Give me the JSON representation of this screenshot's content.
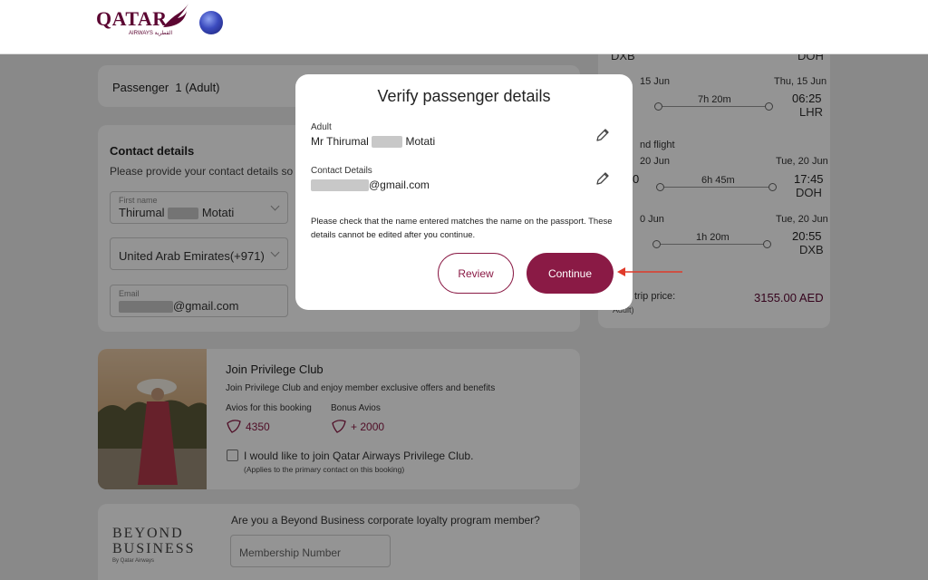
{
  "header": {
    "brand": "QATAR",
    "brand_sub": "AIRWAYS القطرية"
  },
  "passenger_card": {
    "title": "Passenger  1 (Adult)"
  },
  "contact": {
    "title": "Contact details",
    "subtitle": "Please provide your contact details so",
    "first_name": {
      "label": "First name",
      "value_first": "Thirumal",
      "value_last": "Motati"
    },
    "country": {
      "value": "United Arab Emirates(+971)"
    },
    "email": {
      "label": "Email",
      "value": "@gmail.com"
    }
  },
  "privilege": {
    "title": "Join Privilege Club",
    "desc": "Join Privilege Club and enjoy member exclusive offers and benefits",
    "avios_label": "Avios for this booking",
    "avios_value": "4350",
    "bonus_label": "Bonus Avios",
    "bonus_value": "+ 2000",
    "checkbox_label": "I would like to join Qatar Airways Privilege Club.",
    "checkbox_note": "(Applies to the primary contact on this booking)"
  },
  "beyond": {
    "logo_line1": "BEYOND",
    "logo_line2": "BUSINESS",
    "logo_line3": "By Qatar Airways",
    "question": "Are you a Beyond Business corporate loyalty program member?",
    "placeholder": "Membership Number"
  },
  "itinerary": {
    "top_left_code": "DXB",
    "top_right_code": "DOH",
    "seg1": {
      "date_left": "15 Jun",
      "date_right": "Thu, 15 Jun",
      "duration": "7h 20m",
      "time_right": "06:25",
      "code_right": "LHR"
    },
    "return_label": "nd flight",
    "seg2": {
      "date_left": "20 Jun",
      "date_right": "Tue, 20 Jun",
      "time_left": "0",
      "duration": "6h 45m",
      "time_right": "17:45",
      "code_right": "DOH"
    },
    "seg3": {
      "date_left": "0 Jun",
      "date_right": "Tue, 20 Jun",
      "duration": "1h 20m",
      "time_right": "20:55",
      "code_right": "DXB"
    },
    "price_label": "trip price:",
    "price_sub": "Adult)",
    "price_value": "3155.00 AED"
  },
  "modal": {
    "title": "Verify passenger details",
    "adult_label": "Adult",
    "adult_name_first": "Mr Thirumal",
    "adult_name_last": "Motati",
    "contact_label": "Contact Details",
    "contact_value": "@gmail.com",
    "note": "Please check that the name entered matches the name on the passport. These details cannot be edited after you continue.",
    "review_label": "Review",
    "continue_label": "Continue"
  },
  "colors": {
    "brand": "#5c0632",
    "accent": "#8a1a45",
    "annotation_arrow": "#e03a2a"
  },
  "icons": [
    "pencil-icon",
    "chevron-down-icon",
    "avios-icon",
    "oneworld-logo"
  ]
}
